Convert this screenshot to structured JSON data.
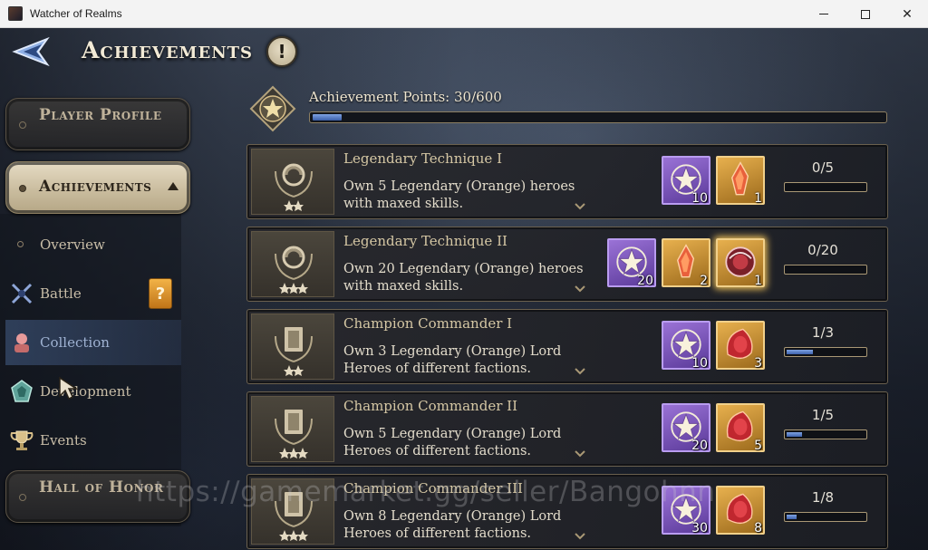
{
  "window": {
    "title": "Watcher of Realms",
    "controls": {
      "minimize": "minimize-icon",
      "maximize": "maximize-icon",
      "close": "close-icon"
    }
  },
  "header": {
    "title": "Achievements",
    "back_icon": "back-arrow-icon",
    "info_label": "!"
  },
  "sidebar": {
    "player_profile": "Player Profile",
    "achievements": "Achievements",
    "sub_items": [
      {
        "label": "Overview",
        "icon": "dot-icon"
      },
      {
        "label": "Battle",
        "icon": "crossed-swords-icon",
        "badge": "?"
      },
      {
        "label": "Collection",
        "icon": "hero-collection-icon",
        "selected": true
      },
      {
        "label": "Development",
        "icon": "gem-icon"
      },
      {
        "label": "Events",
        "icon": "trophy-icon"
      }
    ],
    "hall_of_honor": "Hall of Honor"
  },
  "points": {
    "label": "Achievement Points:",
    "value": "30/600",
    "current": 30,
    "max": 600
  },
  "achievements": [
    {
      "name": "Legendary Technique I",
      "desc_line1": "Own 5 Legendary (Orange) heroes",
      "desc_line2": "with maxed skills.",
      "emblem": "swirl-laurel-icon",
      "stars": 2,
      "progress_text": "0/5",
      "progress": 0,
      "rewards": [
        {
          "type": "purple",
          "icon": "star-wreath-icon",
          "qty": "10"
        },
        {
          "type": "gold",
          "icon": "fire-crystal-icon",
          "qty": "1"
        }
      ]
    },
    {
      "name": "Legendary Technique II",
      "desc_line1": "Own 20 Legendary (Orange) heroes",
      "desc_line2": "with maxed skills.",
      "emblem": "swirl-laurel-icon",
      "stars": 3,
      "progress_text": "0/20",
      "progress": 0,
      "rewards": [
        {
          "type": "purple",
          "icon": "star-wreath-icon",
          "qty": "20"
        },
        {
          "type": "gold",
          "icon": "fire-crystal-icon",
          "qty": "2"
        },
        {
          "type": "gold",
          "icon": "dragon-orb-icon",
          "qty": "1",
          "glow": true
        }
      ]
    },
    {
      "name": "Champion Commander I",
      "desc_line1": "Own 3 Legendary (Orange) Lord",
      "desc_line2": "Heroes of different factions.",
      "emblem": "tome-laurel-icon",
      "stars": 2,
      "progress_text": "1/3",
      "progress": 0.3333,
      "rewards": [
        {
          "type": "purple",
          "icon": "star-wreath-icon",
          "qty": "10"
        },
        {
          "type": "gold",
          "icon": "red-gem-icon",
          "qty": "3"
        }
      ]
    },
    {
      "name": "Champion Commander II",
      "desc_line1": "Own 5 Legendary (Orange) Lord",
      "desc_line2": "Heroes of different factions.",
      "emblem": "tome-laurel-icon",
      "stars": 3,
      "progress_text": "1/5",
      "progress": 0.2,
      "rewards": [
        {
          "type": "purple",
          "icon": "star-wreath-icon",
          "qty": "20"
        },
        {
          "type": "gold",
          "icon": "red-gem-icon",
          "qty": "5"
        }
      ]
    },
    {
      "name": "Champion Commander III",
      "desc_line1": "Own 8 Legendary (Orange) Lord",
      "desc_line2": "Heroes of different factions.",
      "emblem": "tome-laurel-icon",
      "stars": 3,
      "progress_text": "1/8",
      "progress": 0.125,
      "rewards": [
        {
          "type": "purple",
          "icon": "star-wreath-icon",
          "qty": "30"
        },
        {
          "type": "gold",
          "icon": "red-gem-icon",
          "qty": "8"
        }
      ]
    }
  ],
  "watermark": "https://gamemarket.gg/seller/Bangohnn",
  "colors": {
    "accent_blue": "#5b82cc",
    "gold": "#e7b04e",
    "purple": "#7b55bb",
    "frame": "#8d7f62"
  }
}
